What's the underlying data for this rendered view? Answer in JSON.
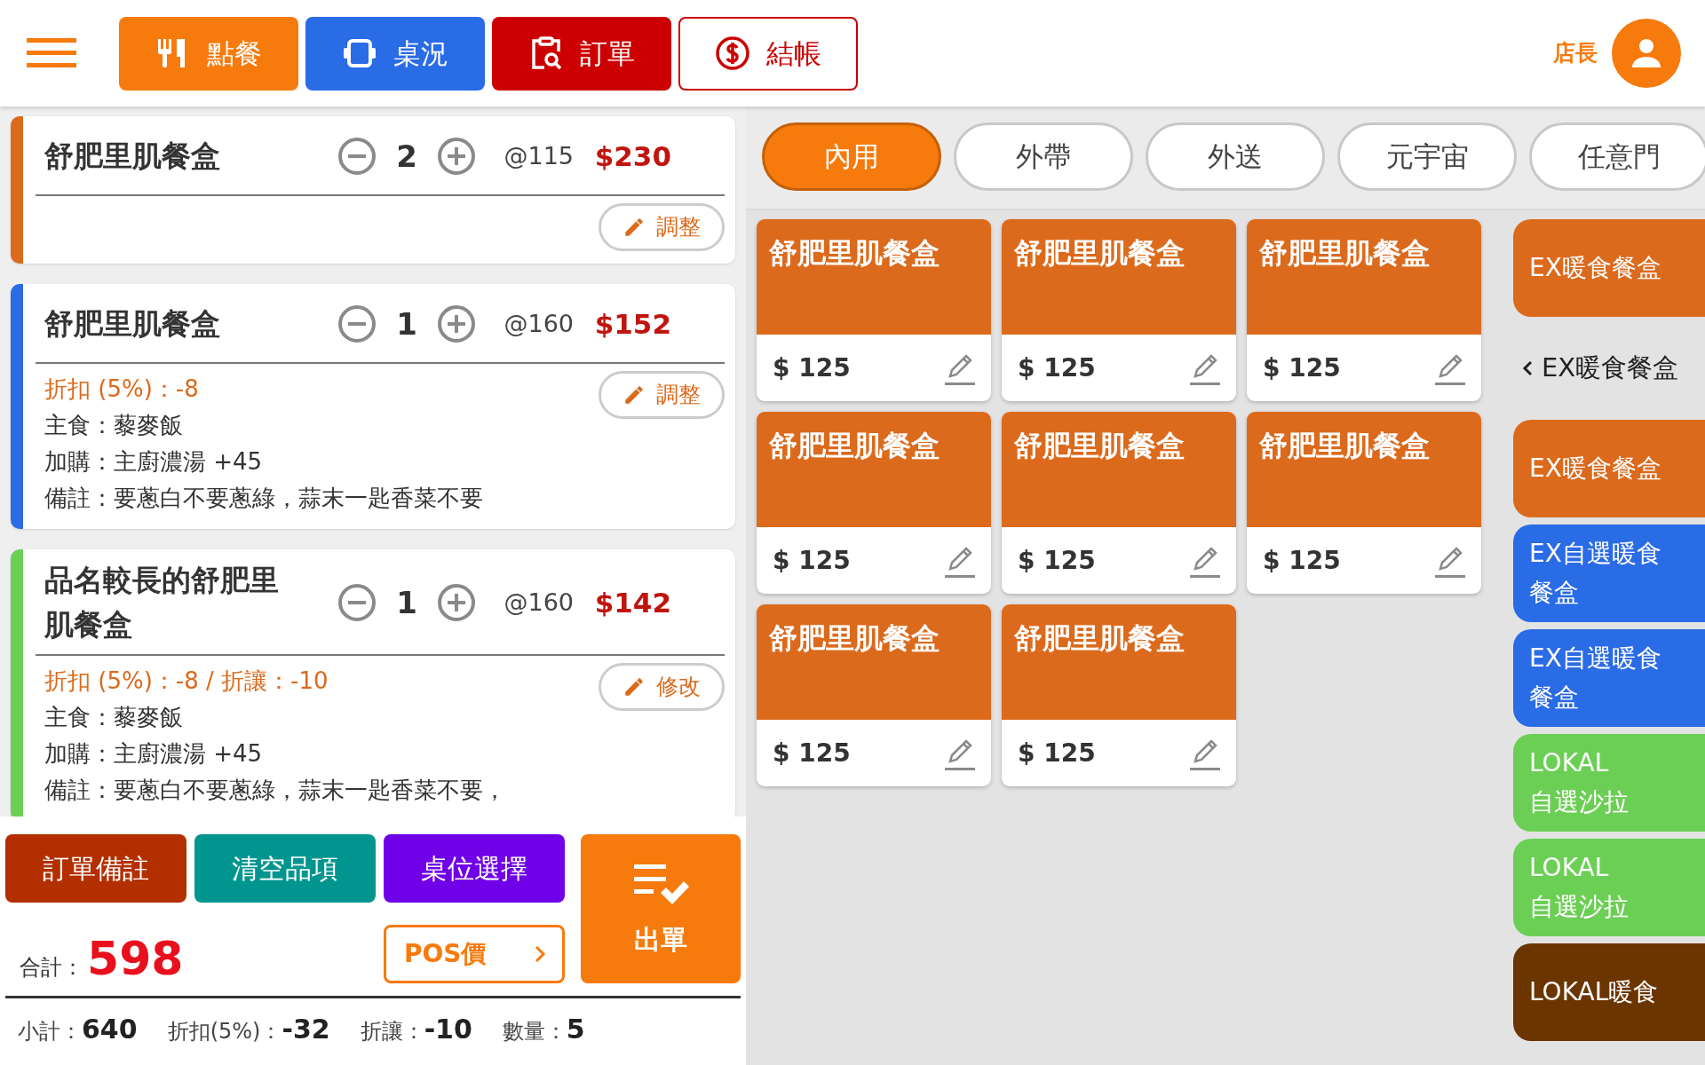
{
  "header": {
    "nav": [
      {
        "label": "點餐",
        "kind": "filled",
        "color": "#f77a0c"
      },
      {
        "label": "桌況",
        "kind": "filled",
        "color": "#2a6be6"
      },
      {
        "label": "訂單",
        "kind": "filled",
        "color": "#cc0000"
      },
      {
        "label": "結帳",
        "kind": "outline",
        "color": "#cc0000"
      }
    ],
    "user": {
      "label": "店長"
    }
  },
  "orders": [
    {
      "name": "舒肥里肌餐盒",
      "qty": "2",
      "unit": "@115",
      "price": "$230",
      "color": "#dc6a1c",
      "button": "調整"
    },
    {
      "name": "舒肥里肌餐盒",
      "qty": "1",
      "unit": "@160",
      "price": "$152",
      "color": "#2a6be6",
      "details": [
        {
          "kind": "discount",
          "text": "折扣 (5%)：-8"
        },
        {
          "kind": "plain",
          "text": "主食：藜麥飯"
        },
        {
          "kind": "plain",
          "text": "加購：主廚濃湯 +45"
        },
        {
          "kind": "plain",
          "text": "備註：要蔥白不要蔥綠，蒜末一匙香菜不要"
        }
      ],
      "button": "調整"
    },
    {
      "name": "品名較長的舒肥里肌餐盒",
      "qty": "1",
      "unit": "@160",
      "price": "$142",
      "color": "#6ccf55",
      "details": [
        {
          "kind": "discount",
          "text": "折扣 (5%)：-8 / 折讓：-10"
        },
        {
          "kind": "plain",
          "text": "主食：藜麥飯"
        },
        {
          "kind": "plain",
          "text": "加購：主廚濃湯 +45"
        },
        {
          "kind": "plain",
          "text": "備註：要蔥白不要蔥綠，蒜末一匙香菜不要，"
        }
      ],
      "button": "修改"
    }
  ],
  "actions": [
    {
      "label": "訂單備註",
      "color": "#b32f00"
    },
    {
      "label": "清空品項",
      "color": "#00968f"
    },
    {
      "label": "桌位選擇",
      "color": "#7000e8"
    }
  ],
  "total": {
    "label": "合計：",
    "value": "598"
  },
  "pos_button": {
    "label": "POS價"
  },
  "submit": {
    "label": "出單"
  },
  "summary": [
    {
      "label": "小計：",
      "value": "640"
    },
    {
      "label": "折扣(5%)：",
      "value": "-32"
    },
    {
      "label": "折讓：",
      "value": "-10"
    },
    {
      "label": "數量：",
      "value": "5"
    }
  ],
  "categories": [
    {
      "label": "內用",
      "selected": true
    },
    {
      "label": "外帶",
      "selected": false
    },
    {
      "label": "外送",
      "selected": false
    },
    {
      "label": "元宇宙",
      "selected": false
    },
    {
      "label": "任意門",
      "selected": false
    }
  ],
  "products": [
    {
      "name": "舒肥里肌餐盒",
      "price": "$ 125"
    },
    {
      "name": "舒肥里肌餐盒",
      "price": "$ 125"
    },
    {
      "name": "舒肥里肌餐盒",
      "price": "$ 125"
    },
    {
      "name": "舒肥里肌餐盒",
      "price": "$ 125"
    },
    {
      "name": "舒肥里肌餐盒",
      "price": "$ 125"
    },
    {
      "name": "舒肥里肌餐盒",
      "price": "$ 125"
    },
    {
      "name": "舒肥里肌餐盒",
      "price": "$ 125"
    },
    {
      "name": "舒肥里肌餐盒",
      "price": "$ 125"
    }
  ],
  "sidebar": {
    "items": [
      {
        "kind": "group",
        "label": "EX暖食餐盒",
        "color": "#dc6a1c"
      },
      {
        "kind": "back",
        "label": "EX暖食餐盒"
      },
      {
        "kind": "group",
        "label": "EX暖食餐盒",
        "color": "#dc6a1c"
      },
      {
        "kind": "group",
        "label": "EX自選暖食餐盒",
        "color": "#2a6be6"
      },
      {
        "kind": "group",
        "label": "EX自選暖食餐盒",
        "color": "#2a6be6"
      },
      {
        "kind": "group",
        "label": "LOKAL\n自選沙拉",
        "color": "#6ccf55"
      },
      {
        "kind": "group",
        "label": "LOKAL\n自選沙拉",
        "color": "#6ccf55"
      },
      {
        "kind": "group",
        "label": "LOKAL暖食",
        "color": "#6b3500"
      }
    ]
  }
}
